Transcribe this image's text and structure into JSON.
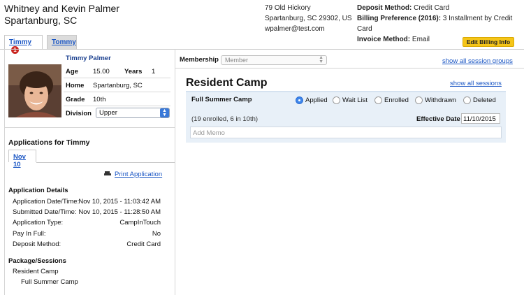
{
  "header": {
    "family_line1": "Whitney and Kevin Palmer",
    "family_line2": "Spartanburg, SC",
    "address_line1": "79 Old Hickory",
    "address_line2": "Spartanburg, SC 29302, US",
    "email": "wpalmer@test.com",
    "billing": [
      {
        "label": "Deposit Method:",
        "value": "Credit Card"
      },
      {
        "label": "Billing Preference (2016):",
        "value": "3 Installment by Credit Card"
      },
      {
        "label": "Invoice Method:",
        "value": "Email"
      }
    ],
    "edit_billing_label": "Edit Billing Info"
  },
  "tabs": [
    {
      "label": "Timmy",
      "badge": "1",
      "active": true
    },
    {
      "label": "Tommy",
      "active": false
    }
  ],
  "camper": {
    "name": "Timmy Palmer",
    "age_label": "Age",
    "age_value": "15.00",
    "years_label": "Years",
    "years_value": "1",
    "home_label": "Home",
    "home_value": "Spartanburg, SC",
    "grade_label": "Grade",
    "grade_value": "10th",
    "division_label": "Division",
    "division_value": "Upper"
  },
  "applications": {
    "title": "Applications for Timmy",
    "date_tab": "Nov 10",
    "print_label": "Print Application",
    "details_heading": "Application Details",
    "details": [
      {
        "label": "Application Date/Time:",
        "value": "Nov 10, 2015 - 11:03:42 AM"
      },
      {
        "label": "Submitted Date/Time:",
        "value": "Nov 10, 2015 - 11:28:50 AM"
      },
      {
        "label": "Application Type:",
        "value": "CampInTouch"
      },
      {
        "label": "Pay In Full:",
        "value": "No"
      },
      {
        "label": "Deposit Method:",
        "value": "Credit Card"
      }
    ],
    "package_heading": "Package/Sessions",
    "package": "Resident Camp",
    "session": "Full Summer Camp"
  },
  "membership": {
    "label": "Membership",
    "placeholder": "Member",
    "show_groups_label": "show all session groups"
  },
  "camp": {
    "title": "Resident Camp",
    "show_sessions_label": "show all sessions",
    "session_name": "Full Summer Camp",
    "statuses": [
      "Applied",
      "Wait List",
      "Enrolled",
      "Withdrawn",
      "Deleted"
    ],
    "selected_status": "Applied",
    "enrolled_text": "(19 enrolled, 6 in 10th)",
    "effective_date_label": "Effective Date",
    "effective_date_value": "11/10/2015",
    "memo_placeholder": "Add Memo"
  },
  "colors": {
    "link": "#1a56c4",
    "badge": "#c9231d",
    "edit_button": "#f5c518",
    "session_bg": "#e8f0f8",
    "radio_selected": "#3f86ea"
  }
}
